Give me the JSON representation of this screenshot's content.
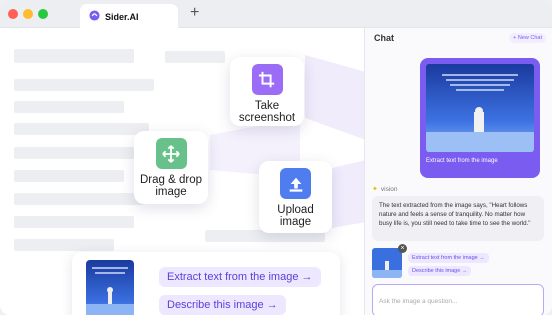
{
  "browser": {
    "tab_title": "Sider.AI",
    "new_tab_symbol": "+",
    "dots": [
      "#ff5f57",
      "#febc2e",
      "#28c840"
    ],
    "accent": "#7b5cf0"
  },
  "features": [
    {
      "label": "Take\nscreenshot",
      "icon": "crop-icon",
      "color": "#9b6cf5"
    },
    {
      "label": "Drag & drop\nimage",
      "icon": "move-icon",
      "color": "#68c18a"
    },
    {
      "label": "Upload\nimage",
      "icon": "upload-icon",
      "color": "#4f7df0"
    }
  ],
  "chat": {
    "title": "Chat",
    "new_chat_label": "+ New Chat",
    "user_image_caption": "Extract text from the image",
    "bot_name": "vision",
    "bot_reply": "The text extracted from the image says, \"Heart follows nature and feels a sense of tranquility. No matter how busy life is, you still need to take time to see the world.\"",
    "chips": [
      "Extract text from the image →",
      "Describe this image →"
    ],
    "input_placeholder": "Ask the image a question..."
  },
  "bottom_panel": {
    "chips": [
      "Extract text from the image →",
      "Describe this image →"
    ]
  }
}
